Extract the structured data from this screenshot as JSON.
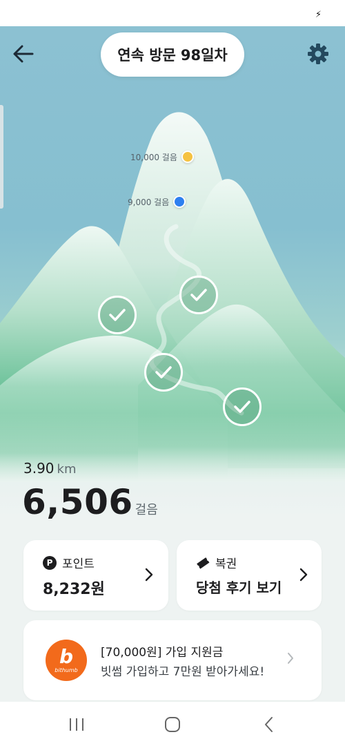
{
  "status_bar": {
    "icon": "lightning-bolt-icon"
  },
  "header": {
    "back_icon": "arrow-left-icon",
    "visit_label": "연속 방문",
    "visit_day": "98일차",
    "settings_icon": "gear-icon"
  },
  "milestones": [
    {
      "label": "10,000 걸음",
      "color": "#f5c242"
    },
    {
      "label": "9,000 걸음",
      "color": "#2e7ff0"
    }
  ],
  "completed_checkpoints": 4,
  "stats": {
    "distance_value": "3.90",
    "distance_unit": "km",
    "steps_value": "6,506",
    "steps_unit": "걸음"
  },
  "cards": {
    "points": {
      "badge": "P",
      "title": "포인트",
      "value": "8,232원"
    },
    "lottery": {
      "icon": "ticket-icon",
      "title": "복권",
      "value": "당첨 후기 보기"
    }
  },
  "ad": {
    "logo_letter": "b",
    "logo_word": "bithumb",
    "title": "[70,000원] 가입 지원금",
    "subtitle": "빗썸 가입하고 7만원 받아가세요!"
  },
  "nav": {
    "recent_icon": "recent-apps-icon",
    "home_icon": "home-icon",
    "back_icon": "nav-back-icon"
  },
  "colors": {
    "accent_green": "#5bbf95",
    "sky": "#86bfd0",
    "bithumb_orange": "#f26a1b"
  }
}
